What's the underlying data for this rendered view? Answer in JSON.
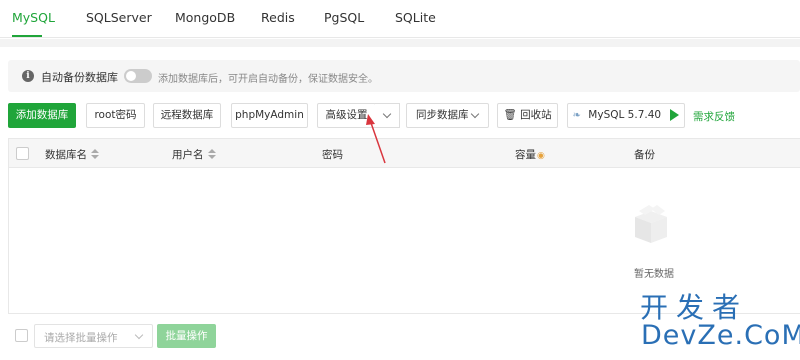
{
  "tabs": [
    "MySQL",
    "SQLServer",
    "MongoDB",
    "Redis",
    "PgSQL",
    "SQLite"
  ],
  "notice": {
    "label": "自动备份数据库",
    "hint": "添加数据库后，可开启自动备份，保证数据安全。",
    "toggle_on": false
  },
  "toolbar": {
    "add_db": "添加数据库",
    "root_password": "root密码",
    "remote_db": "远程数据库",
    "phpmyadmin": "phpMyAdmin",
    "advanced": "高级设置",
    "sync_db": "同步数据库",
    "recycle": "回收站",
    "mysql_version": "MySQL 5.7.40",
    "feedback": "需求反馈"
  },
  "table": {
    "columns": [
      "数据库名",
      "用户名",
      "密码",
      "容量",
      "备份"
    ],
    "rows": [],
    "empty_text": "暂无数据"
  },
  "bottom": {
    "batch_placeholder": "请选择批量操作",
    "batch_button": "批量操作"
  },
  "watermark": {
    "line1": "开发者",
    "line2": "DevZe.CoM"
  },
  "colors": {
    "accent": "#20a53a",
    "annotation": "#d9363e",
    "watermark": "#2a6fb5"
  }
}
